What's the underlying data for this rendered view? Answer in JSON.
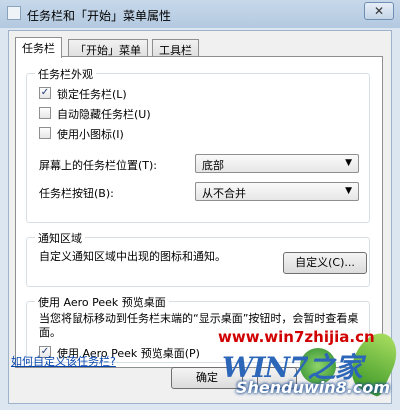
{
  "window": {
    "title": "任务栏和「开始」菜单属性",
    "close_glyph": "✕"
  },
  "tabs": [
    {
      "label": "任务栏",
      "active": true
    },
    {
      "label": "「开始」菜单",
      "active": false
    },
    {
      "label": "工具栏",
      "active": false
    }
  ],
  "appearance": {
    "group_label": "任务栏外观",
    "checkboxes": [
      {
        "label": "锁定任务栏(L)",
        "checked": true
      },
      {
        "label": "自动隐藏任务栏(U)",
        "checked": false
      },
      {
        "label": "使用小图标(I)",
        "checked": false
      }
    ],
    "position_label": "屏幕上的任务栏位置(T):",
    "position_value": "底部",
    "buttons_label": "任务栏按钮(B):",
    "buttons_value": "从不合并"
  },
  "notify": {
    "group_label": "通知区域",
    "desc": "自定义通知区域中出现的图标和通知。",
    "customize_button": "自定义(C)..."
  },
  "aero": {
    "group_label": "使用 Aero Peek 预览桌面",
    "desc": "当您将鼠标移动到任务栏末端的“显示桌面”按钮时，会暂时查看桌面。",
    "checkbox_label": "使用 Aero Peek 预览桌面(P)",
    "checked": true
  },
  "help_link": "如何自定义该任务栏?",
  "ok_button": "确定",
  "watermark": {
    "url": "www.win7zhijia.cn",
    "logo": "WIN7之家",
    "site": "Shenduwin8.com"
  },
  "colors": {
    "link": "#0645ad",
    "watermark_red": "#d10000",
    "watermark_blue": "#2c66b8"
  }
}
